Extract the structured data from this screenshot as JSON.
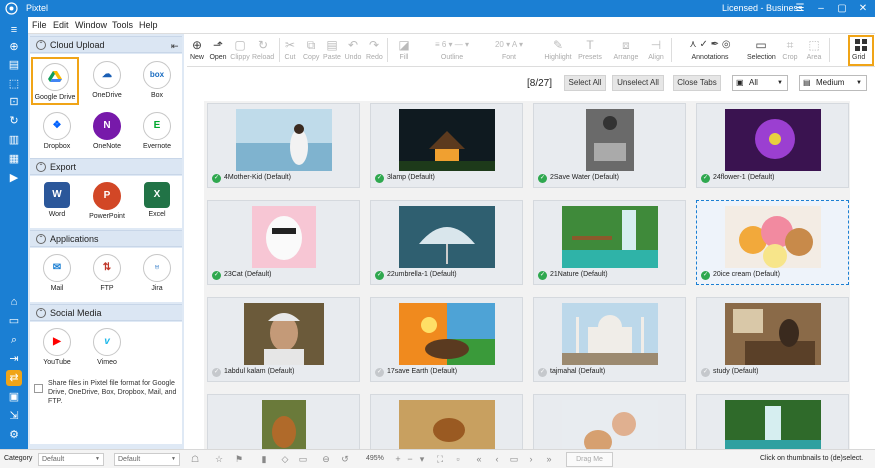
{
  "window": {
    "title": "Pixtel",
    "license": "Licensed - Business"
  },
  "menu": [
    "File",
    "Edit",
    "Window",
    "Tools",
    "Help"
  ],
  "toolbar": {
    "new": "New",
    "open": "Open",
    "clippy": "Clippy",
    "reload": "Reload",
    "cut": "Cut",
    "copy": "Copy",
    "paste": "Paste",
    "undo": "Undo",
    "redo": "Redo",
    "fill": "Fill",
    "outline": "Outline",
    "outline_size": "6",
    "font": "Font",
    "font_size": "20",
    "highlight": "Highlight",
    "presets": "Presets",
    "arrange": "Arrange",
    "align": "Align",
    "annotations": "Annotations",
    "selection": "Selection",
    "crop": "Crop",
    "area": "Area",
    "grid": "Grid"
  },
  "sidepanel": {
    "cloud_upload": {
      "title": "Cloud Upload",
      "items": [
        "Google Drive",
        "OneDrive",
        "Box",
        "Dropbox",
        "OneNote",
        "Evernote"
      ]
    },
    "export": {
      "title": "Export",
      "items": [
        "Word",
        "PowerPoint",
        "Excel"
      ]
    },
    "applications": {
      "title": "Applications",
      "items": [
        "Mail",
        "FTP",
        "Jira"
      ]
    },
    "social_media": {
      "title": "Social Media",
      "items": [
        "YouTube",
        "Vimeo"
      ]
    },
    "share_note": "Share files in Pixtel file format for Google Drive, OneDrive, Box, Dropbox, Mail, and FTP.",
    "icon_glyphs": {
      "box": "box",
      "onenote": "N",
      "evernote": "E",
      "word": "W",
      "powerpoint": "P",
      "excel": "X"
    }
  },
  "content": {
    "count": "[8/27]",
    "select_all": "Select All",
    "unselect_all": "Unselect All",
    "close_tabs": "Close Tabs",
    "filter": "All",
    "size": "Medium"
  },
  "thumbnails": [
    {
      "caption": "4Mother-Kid (Default)",
      "checked": true
    },
    {
      "caption": "3lamp (Default)",
      "checked": true
    },
    {
      "caption": "2Save Water (Default)",
      "checked": true
    },
    {
      "caption": "24flower-1 (Default)",
      "checked": true
    },
    {
      "caption": "23Cat (Default)",
      "checked": true
    },
    {
      "caption": "22umbrella-1 (Default)",
      "checked": true
    },
    {
      "caption": "21Nature (Default)",
      "checked": true
    },
    {
      "caption": "20ice cream (Default)",
      "checked": true
    },
    {
      "caption": "1abdul kalam (Default)",
      "checked": false
    },
    {
      "caption": "17save Earth (Default)",
      "checked": false
    },
    {
      "caption": "tajmahal (Default)",
      "checked": false
    },
    {
      "caption": "study (Default)",
      "checked": false
    }
  ],
  "statusbar": {
    "category_label": "Category",
    "category_value": "Default",
    "second_value": "Default",
    "zoom": "495%",
    "drag_me": "Drag Me",
    "hint": "Click on thumbnails to (de)select."
  },
  "colors": {
    "accent": "#1b7fd3",
    "highlight": "#f0a417",
    "checked": "#2fa84f"
  }
}
